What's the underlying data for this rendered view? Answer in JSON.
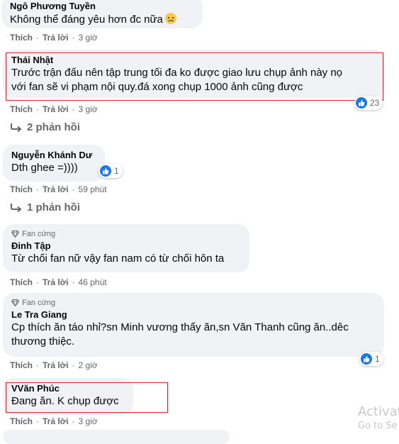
{
  "labels": {
    "like": "Thích",
    "reply": "Trả lời",
    "dot": "·"
  },
  "comments": [
    {
      "author": "Ngô Phương Tuyền",
      "text": "Không thể đáng yêu hơn đc nữa",
      "time": "3 giờ"
    },
    {
      "author": "Thái Nhật",
      "text_line1": "Trước trận đấu nên tập trung tối đa ko được giao lưu chụp ảnh này nọ",
      "text_line2": "với fan sẽ vi phạm nội quy.đá xong chụp 1000 ảnh cũng được",
      "time": "3 giờ",
      "reactions": "23",
      "replies": "2 phản hồi"
    },
    {
      "author": "Nguyễn Khánh Dư",
      "text": "Dth ghee =))))",
      "time": "59 phút",
      "reactions": "1",
      "replies": "1 phản hồi"
    },
    {
      "badge": "Fan cứng",
      "author": "Đinh Tập",
      "text": "Từ chối fan nữ vậy fan nam có từ chối hôn ta",
      "time": "46 phút"
    },
    {
      "badge": "Fan cứng",
      "author": "Le Tra Giang",
      "text_line1": "Cp thích ăn táo nhỉ?sn Minh vương thấy ăn,sn Văn Thanh cũng ăn..dêc",
      "text_line2": "thương thiệc.",
      "time": "2 giờ",
      "reactions": "1"
    },
    {
      "author": "VVăn Phúc",
      "text": "Đang ăn. K chụp được",
      "time": "3 giờ"
    }
  ],
  "watermark": {
    "line1": "Activat",
    "line2": "Go to Se"
  },
  "colors": {
    "highlight": "#d9232e",
    "like": "#1877f2",
    "bubble": "#f0f2f5",
    "meta": "#65676b"
  }
}
